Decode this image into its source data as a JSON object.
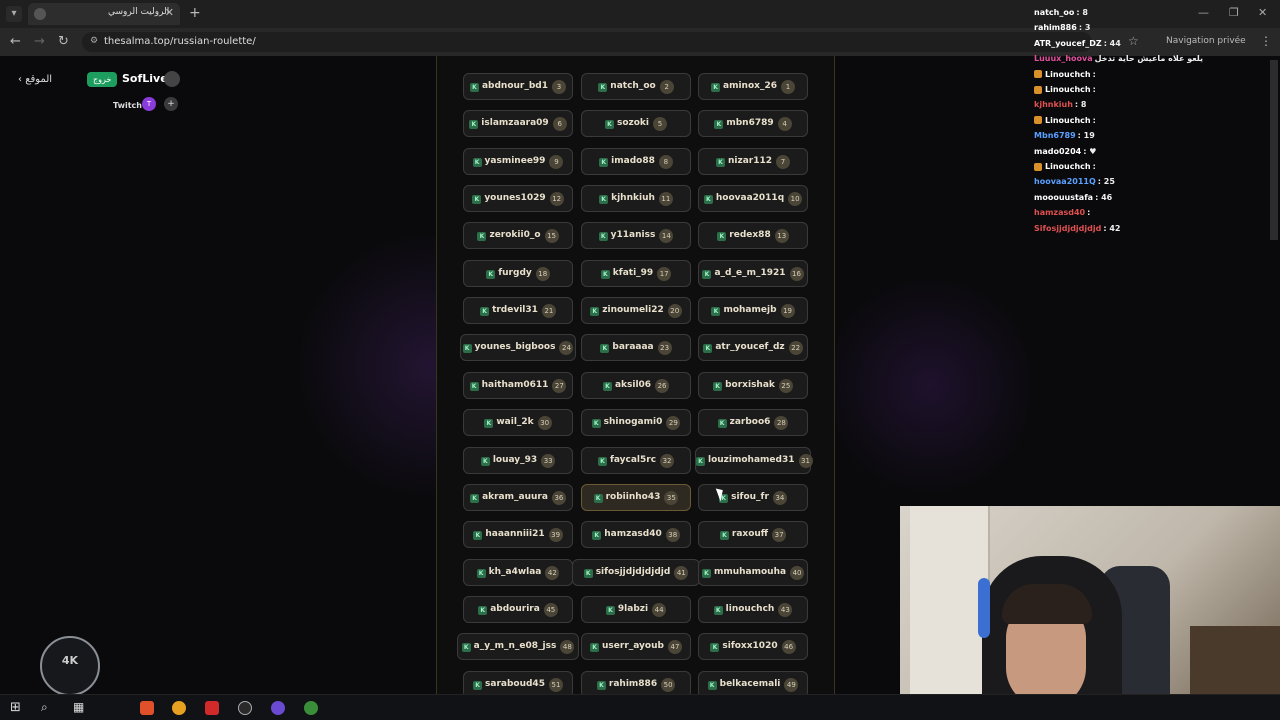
{
  "browser": {
    "tab_title": "الروليت الروسي",
    "url": "thesalma.top/russian-roulette/",
    "private_label": "Navigation privée"
  },
  "site": {
    "site_link": "الموقع",
    "logout_label": "خروج",
    "brand": "SofLive",
    "platform": "Twitch",
    "avatar_initial": "T",
    "add_label": "+"
  },
  "players": [
    {
      "name": "abdnour_bd1",
      "num": "3"
    },
    {
      "name": "natch_oo",
      "num": "2"
    },
    {
      "name": "aminox_26",
      "num": "1"
    },
    {
      "name": "islamzaara09",
      "num": "6"
    },
    {
      "name": "sozoki",
      "num": "5"
    },
    {
      "name": "mbn6789",
      "num": "4"
    },
    {
      "name": "yasminee99",
      "num": "9"
    },
    {
      "name": "imado88",
      "num": "8"
    },
    {
      "name": "nizar112",
      "num": "7"
    },
    {
      "name": "younes1029",
      "num": "12"
    },
    {
      "name": "kjhnkiuh",
      "num": "11"
    },
    {
      "name": "hoovaa2011q",
      "num": "10"
    },
    {
      "name": "zerokii0_o",
      "num": "15"
    },
    {
      "name": "y11aniss",
      "num": "14"
    },
    {
      "name": "redex88",
      "num": "13"
    },
    {
      "name": "furgdy",
      "num": "18"
    },
    {
      "name": "kfati_99",
      "num": "17"
    },
    {
      "name": "a_d_e_m_1921",
      "num": "16"
    },
    {
      "name": "trdevil31",
      "num": "21"
    },
    {
      "name": "zinoumeli22",
      "num": "20"
    },
    {
      "name": "mohamejb",
      "num": "19"
    },
    {
      "name": "younes_bigboos",
      "num": "24"
    },
    {
      "name": "baraaaa",
      "num": "23"
    },
    {
      "name": "atr_youcef_dz",
      "num": "22"
    },
    {
      "name": "haitham0611",
      "num": "27"
    },
    {
      "name": "aksil06",
      "num": "26"
    },
    {
      "name": "borxishak",
      "num": "25"
    },
    {
      "name": "wail_2k",
      "num": "30"
    },
    {
      "name": "shinogami0",
      "num": "29"
    },
    {
      "name": "zarboo6",
      "num": "28"
    },
    {
      "name": "louay_93",
      "num": "33"
    },
    {
      "name": "faycal5rc",
      "num": "32"
    },
    {
      "name": "louzimohamed31",
      "num": "31"
    },
    {
      "name": "akram_auura",
      "num": "36"
    },
    {
      "name": "robiinho43",
      "num": "35"
    },
    {
      "name": "sifou_fr",
      "num": "34"
    },
    {
      "name": "haaanniii21",
      "num": "39"
    },
    {
      "name": "hamzasd40",
      "num": "38"
    },
    {
      "name": "raxouff",
      "num": "37"
    },
    {
      "name": "kh_a4wlaa",
      "num": "42"
    },
    {
      "name": "sifosjjdjdjdjdjd",
      "num": "41"
    },
    {
      "name": "mmuhamouha",
      "num": "40"
    },
    {
      "name": "abdourira",
      "num": "45"
    },
    {
      "name": "9labzi",
      "num": "44"
    },
    {
      "name": "linouchch",
      "num": "43"
    },
    {
      "name": "a_y_m_n_e08_jss",
      "num": "48"
    },
    {
      "name": "userr_ayoub",
      "num": "47"
    },
    {
      "name": "sifoxx1020",
      "num": "46"
    },
    {
      "name": "saraboud45",
      "num": "51"
    },
    {
      "name": "rahim886",
      "num": "50"
    },
    {
      "name": "belkacemali",
      "num": "49"
    }
  ],
  "chat": [
    {
      "user": "natch_oo",
      "msg": ": 8",
      "color": "#ffffff"
    },
    {
      "user": "rahim886",
      "msg": ": 3",
      "color": "#ffffff"
    },
    {
      "user": "ATR_youcef_DZ",
      "msg": ": 44",
      "color": "#ffffff"
    },
    {
      "user": "Luuux_hoova",
      "msg": "يلعو علاه ماعيش حاية تدخل",
      "color": "#e0509c"
    },
    {
      "user": "Linouchch",
      "msg": ":",
      "color": "#ffffff"
    },
    {
      "user": "Linouchch",
      "msg": ":",
      "color": "#ffffff"
    },
    {
      "user": "kjhnkiuh",
      "msg": ": 8",
      "color": "#e05050"
    },
    {
      "user": "Linouchch",
      "msg": ":",
      "color": "#ffffff"
    },
    {
      "user": "Mbn6789",
      "msg": ": 19",
      "color": "#5aa0ff"
    },
    {
      "user": "mado0204",
      "msg": ": ♥",
      "color": "#ffffff"
    },
    {
      "user": "Linouchch",
      "msg": ":",
      "color": "#ffffff"
    },
    {
      "user": "hoovaa2011Q",
      "msg": ": 25",
      "color": "#5aa0ff"
    },
    {
      "user": "mooouustafa",
      "msg": ": 46",
      "color": "#ffffff"
    },
    {
      "user": "hamzasd40",
      "msg": ":",
      "color": "#e05050"
    },
    {
      "user": "Sifosjjdjdjdjdjd",
      "msg": ": 42",
      "color": "#e05050"
    }
  ],
  "watermark": "4K"
}
